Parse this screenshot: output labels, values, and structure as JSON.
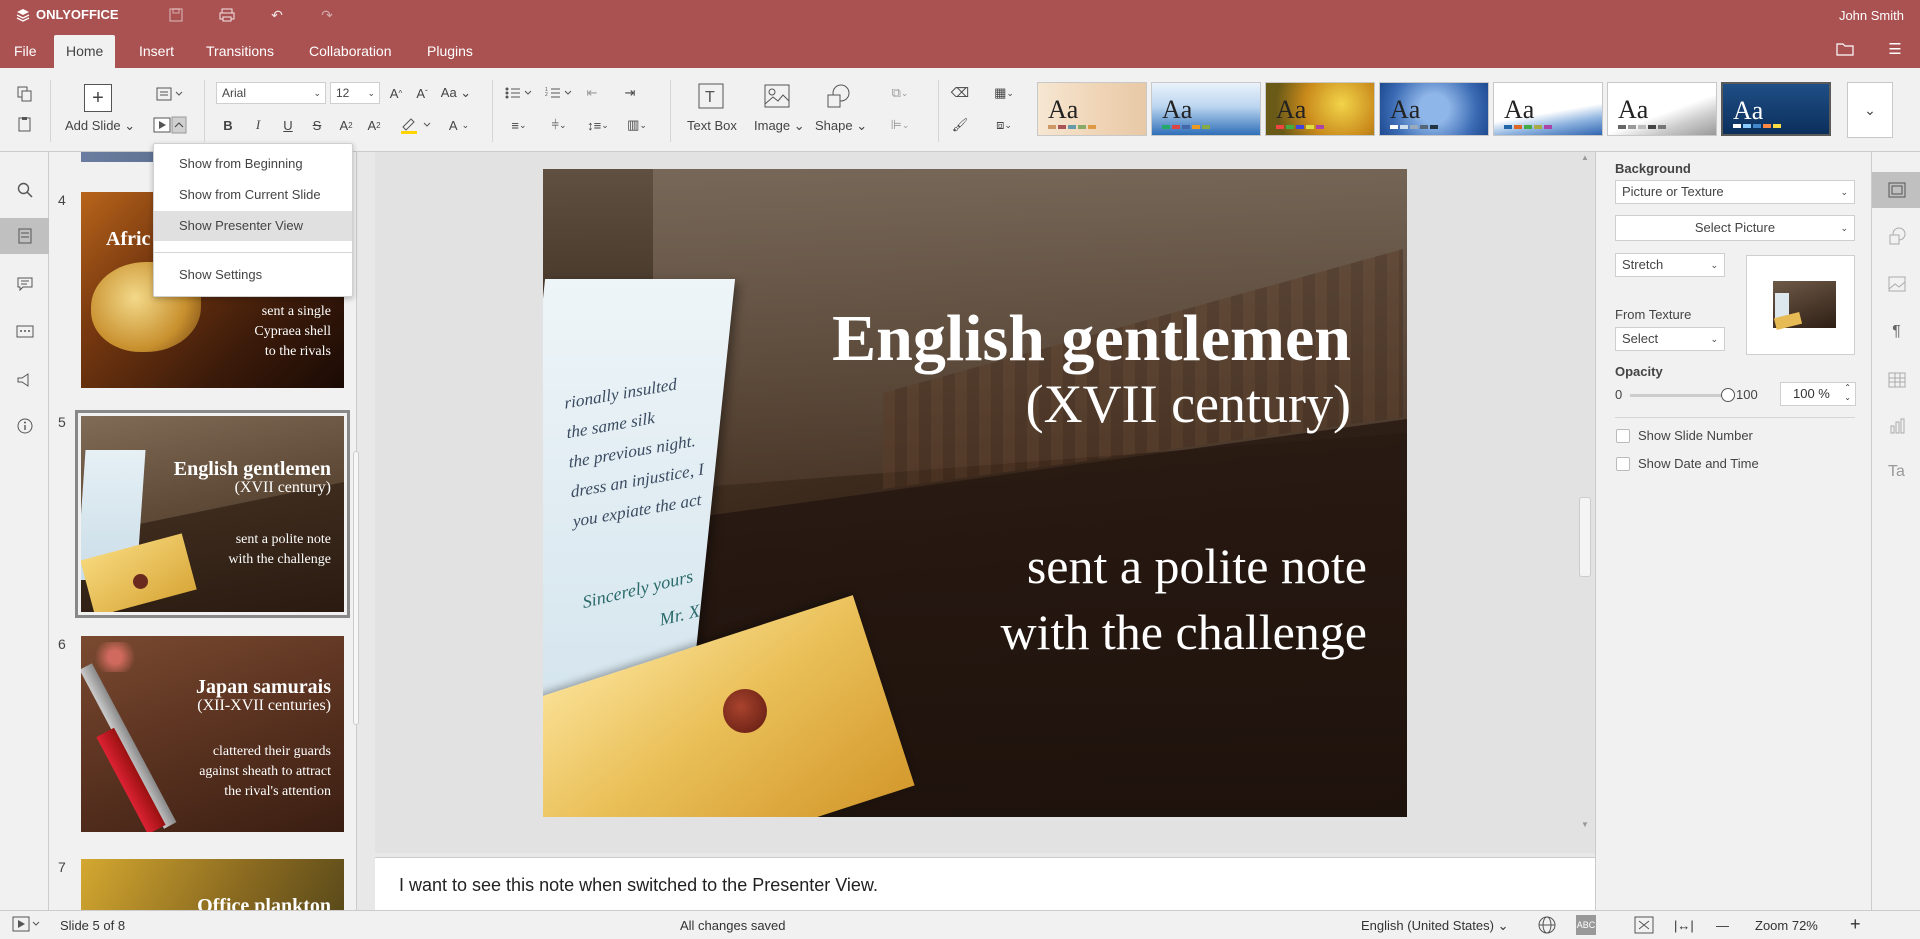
{
  "app": {
    "brand": "ONLYOFFICE",
    "user": "John Smith"
  },
  "menu": {
    "tabs": [
      "File",
      "Home",
      "Insert",
      "Transitions",
      "Collaboration",
      "Plugins"
    ],
    "active_tab": "Home"
  },
  "toolbar": {
    "add_slide": "Add Slide",
    "font_name": "Arial",
    "font_size": "12",
    "text_box": "Text Box",
    "image": "Image",
    "shape": "Shape",
    "theme_sample": "Aa"
  },
  "slideshow_menu": {
    "items": [
      "Show from Beginning",
      "Show from Current Slide",
      "Show Presenter View",
      "Show Settings"
    ],
    "highlighted": "Show Presenter View"
  },
  "thumbnails": [
    {
      "number": "4",
      "title": "Afric",
      "subtitle": "",
      "body": [
        "sent a single",
        "Cypraea shell",
        "to the rivals"
      ]
    },
    {
      "number": "5",
      "title": "English gentlemen",
      "subtitle": "(XVII century)",
      "body": [
        "sent a polite note",
        "with the challenge"
      ],
      "selected": true
    },
    {
      "number": "6",
      "title": "Japan samurais",
      "subtitle": "(XII-XVII centuries)",
      "body": [
        "clattered their guards",
        "against sheath to attract",
        "the rival's attention"
      ]
    },
    {
      "number": "7",
      "title": "Office plankton",
      "subtitle": "",
      "body": []
    }
  ],
  "slide": {
    "title": "English gentlemen",
    "subtitle": "(XVII century)",
    "body_line1": "sent a polite note",
    "body_line2": "with the challenge",
    "letter_lines": [
      "rionally insulted",
      "the same silk",
      "the previous night.",
      "dress an injustice, I",
      "you expiate the act"
    ],
    "letter_sign1": "Sincerely yours",
    "letter_sign2": "Mr. X"
  },
  "notes": {
    "text": "I want to see this note when switched to the Presenter View."
  },
  "right_panel": {
    "background_label": "Background",
    "fill_type": "Picture or Texture",
    "select_picture": "Select Picture",
    "stretch": "Stretch",
    "from_texture_label": "From Texture",
    "texture_select": "Select",
    "opacity_label": "Opacity",
    "opacity_min": "0",
    "opacity_max": "100",
    "opacity_value": "100 %",
    "opacity_level": 1.0,
    "show_slide_number": "Show Slide Number",
    "show_date_time": "Show Date and Time"
  },
  "status": {
    "slide_info": "Slide 5 of 8",
    "save_state": "All changes saved",
    "language": "English (United States)",
    "zoom": "Zoom 72%"
  },
  "colors": {
    "accent": "#aa5252",
    "panel": "#f1f1f1",
    "canvas_bg": "#e2e2e2"
  }
}
